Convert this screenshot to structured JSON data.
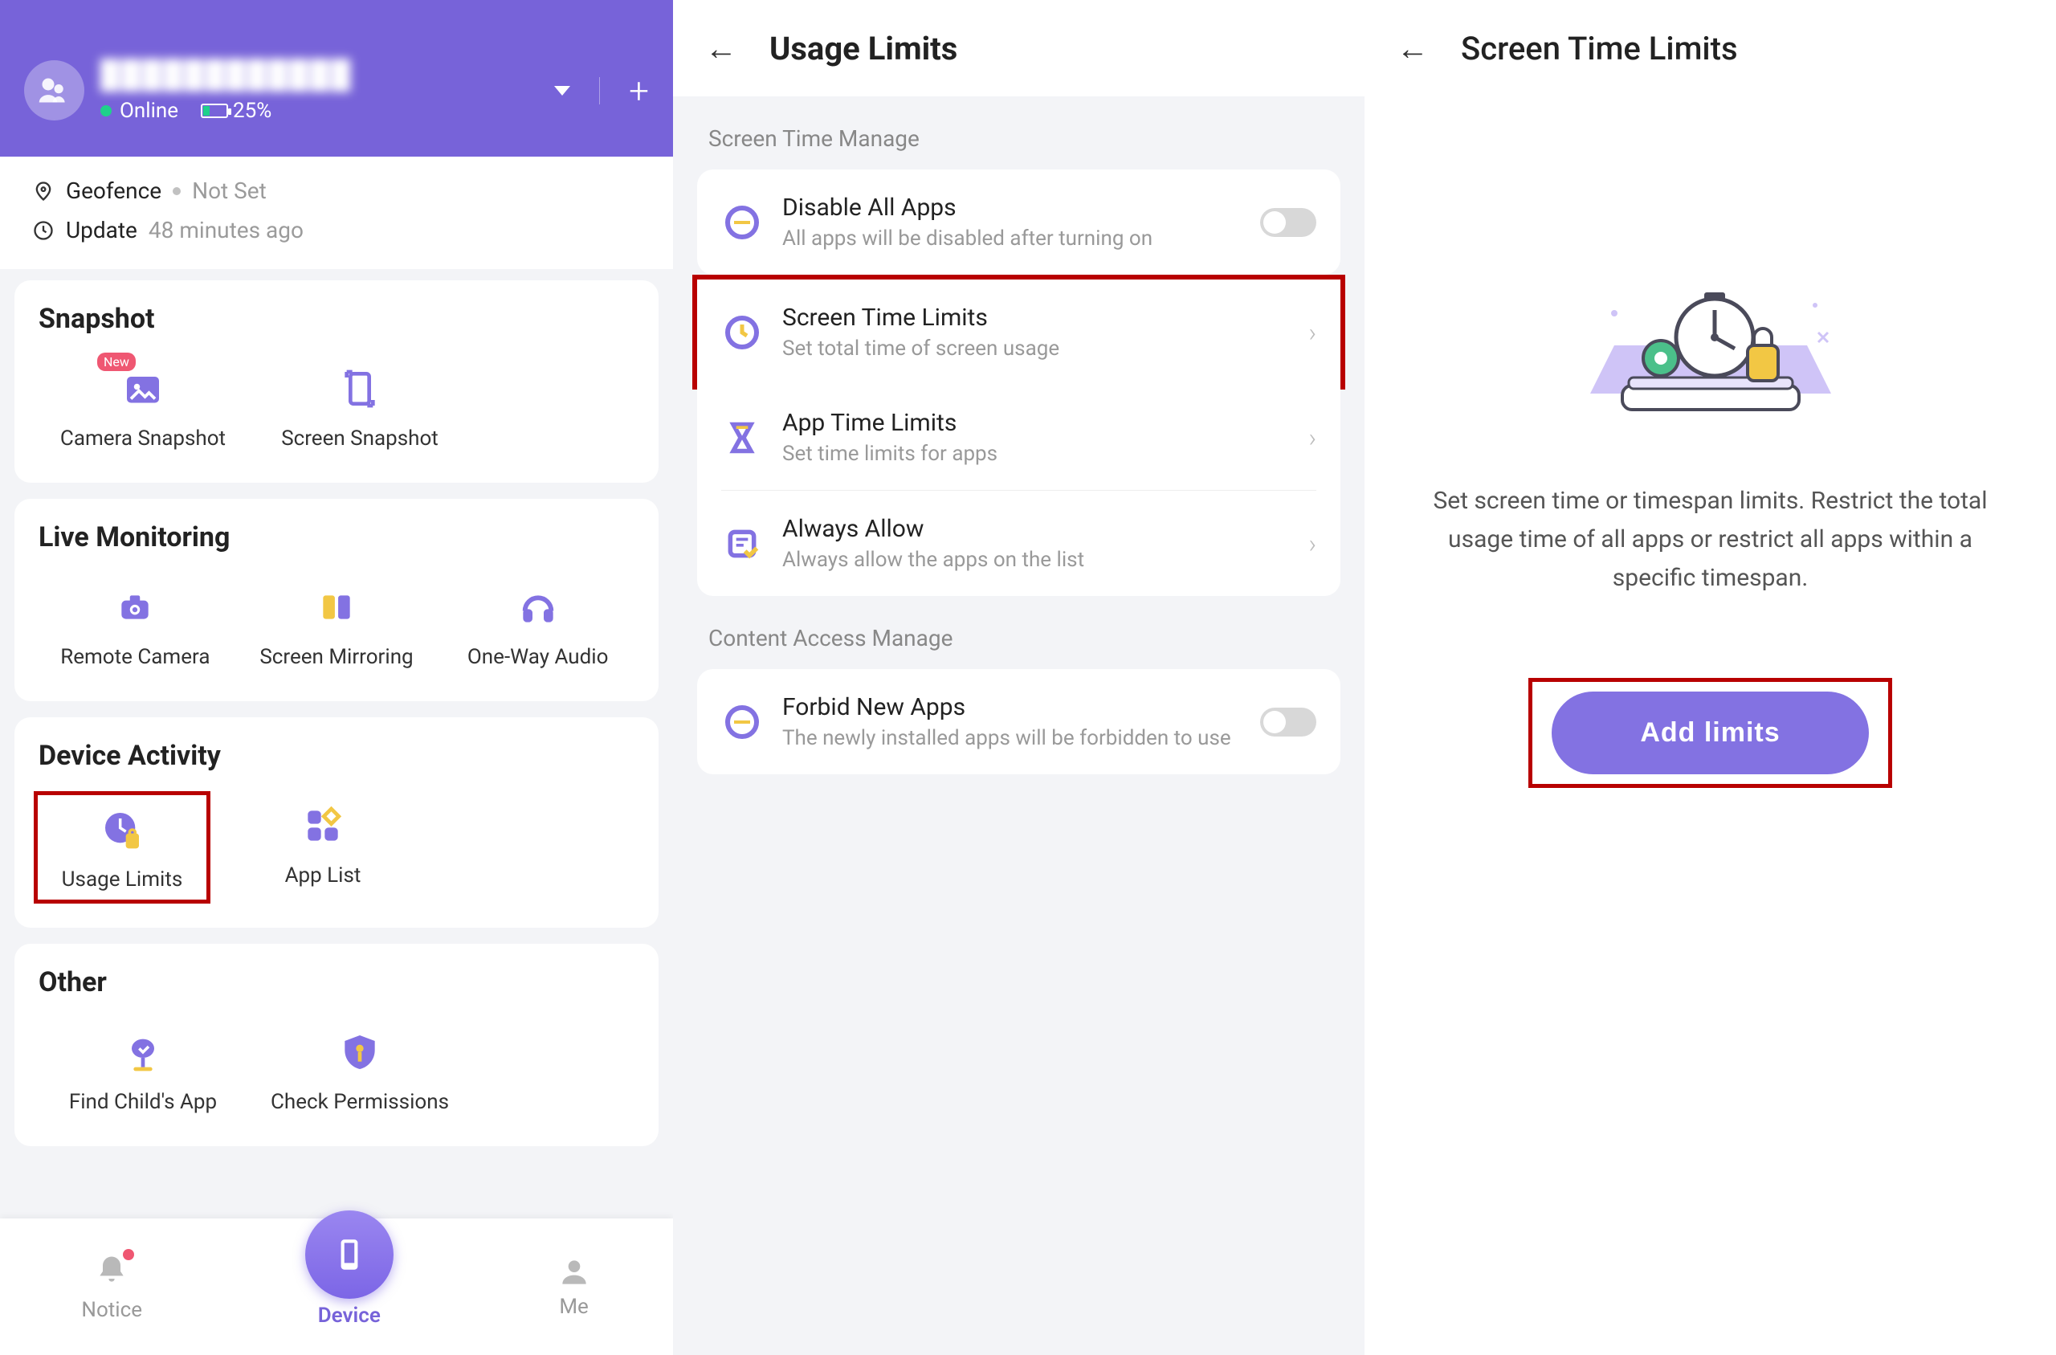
{
  "panel1": {
    "user_name": "████████████",
    "status_online": "Online",
    "battery_pct": "25%",
    "meta": {
      "geofence_label": "Geofence",
      "geofence_value": "Not Set",
      "update_label": "Update",
      "update_value": "48 minutes ago"
    },
    "sections": {
      "snapshot": {
        "title": "Snapshot",
        "items": [
          {
            "label": "Camera Snapshot",
            "icon": "camera-snapshot",
            "new": true
          },
          {
            "label": "Screen Snapshot",
            "icon": "screen-snapshot"
          }
        ]
      },
      "live": {
        "title": "Live Monitoring",
        "items": [
          {
            "label": "Remote Camera",
            "icon": "remote-camera"
          },
          {
            "label": "Screen Mirroring",
            "icon": "screen-mirroring"
          },
          {
            "label": "One-Way Audio",
            "icon": "one-way-audio"
          }
        ]
      },
      "activity": {
        "title": "Device Activity",
        "items": [
          {
            "label": "Usage Limits",
            "icon": "usage-limits",
            "highlight": true
          },
          {
            "label": "App List",
            "icon": "app-list"
          }
        ]
      },
      "other": {
        "title": "Other",
        "items": [
          {
            "label": "Find Child's App",
            "icon": "find-app"
          },
          {
            "label": "Check Permissions",
            "icon": "check-permissions"
          }
        ]
      }
    },
    "tabs": {
      "notice": "Notice",
      "device": "Device",
      "me": "Me"
    }
  },
  "panel2": {
    "title": "Usage Limits",
    "section1": "Screen Time Manage",
    "rows1": [
      {
        "title": "Disable All Apps",
        "desc": "All apps will be disabled after turning on",
        "icon": "disable-apps",
        "toggle": true
      },
      {
        "title": "Screen Time Limits",
        "desc": "Set total time of screen usage",
        "icon": "screen-time-limits",
        "chevron": true,
        "highlight": true
      },
      {
        "title": "App Time Limits",
        "desc": "Set time limits for apps",
        "icon": "app-time-limits",
        "chevron": true
      },
      {
        "title": "Always Allow",
        "desc": "Always allow the apps on the list",
        "icon": "always-allow",
        "chevron": true
      }
    ],
    "section2": "Content Access Manage",
    "rows2": [
      {
        "title": "Forbid New Apps",
        "desc": "The newly installed apps will be forbidden to use",
        "icon": "forbid-new-apps",
        "toggle": true
      }
    ]
  },
  "panel3": {
    "title": "Screen Time Limits",
    "desc": "Set screen time or timespan limits. Restrict the total usage time of all apps or restrict all apps within a specific timespan.",
    "button": "Add limits"
  }
}
